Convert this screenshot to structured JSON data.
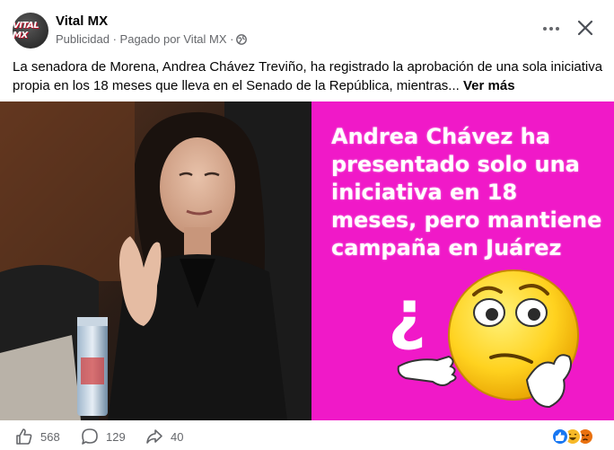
{
  "header": {
    "page_name": "Vital MX",
    "meta_prefix": "Publicidad · Pagado por Vital MX ·",
    "avatar_text": "VITAL MX"
  },
  "post": {
    "text": "La senadora de Morena, Andrea Chávez Treviño, ha registrado la aprobación de una sola iniciativa propia en los 18 meses que lleva en el Senado de la República, mientras...",
    "see_more": "Ver más"
  },
  "image": {
    "headline": "Andrea Chávez ha presentado solo una iniciativa en 18 meses, pero mantiene campaña en Juárez",
    "question_mark": "¿",
    "background_color": "#f019c8"
  },
  "footer": {
    "likes": "568",
    "comments": "129",
    "shares": "40"
  }
}
